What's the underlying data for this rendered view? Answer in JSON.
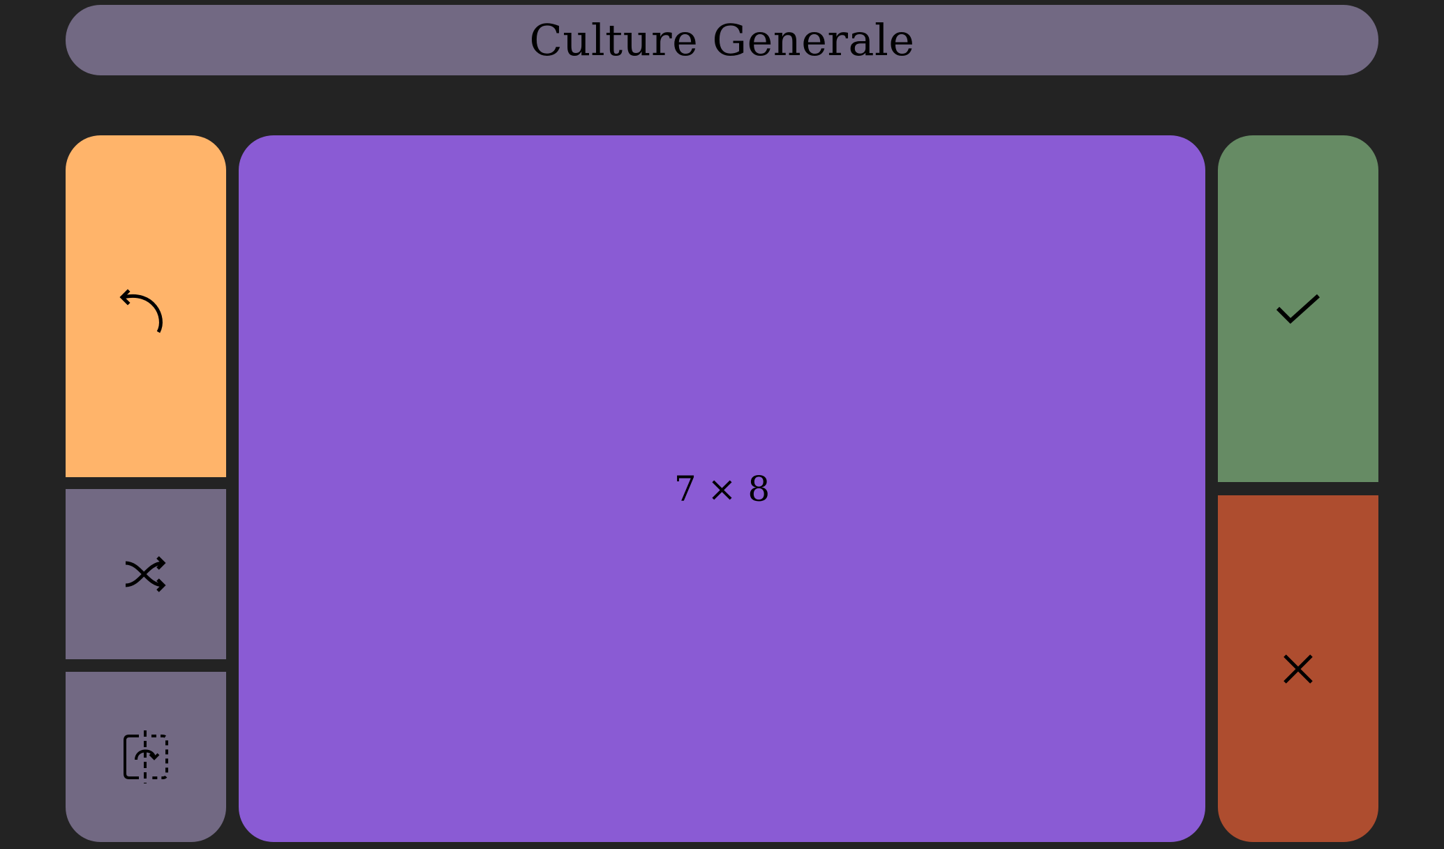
{
  "header": {
    "title": "Culture Generale"
  },
  "card": {
    "text": "7 × 8"
  },
  "colors": {
    "background": "#232323",
    "title_bar": "#726983",
    "undo": "#FFB46A",
    "neutral": "#726983",
    "card": "#8A5BD4",
    "correct": "#668B64",
    "wrong": "#AE4D2F"
  },
  "icons": {
    "undo": "undo-arrow-icon",
    "shuffle": "shuffle-icon",
    "flip": "flip-card-icon",
    "correct": "check-icon",
    "wrong": "close-icon"
  }
}
